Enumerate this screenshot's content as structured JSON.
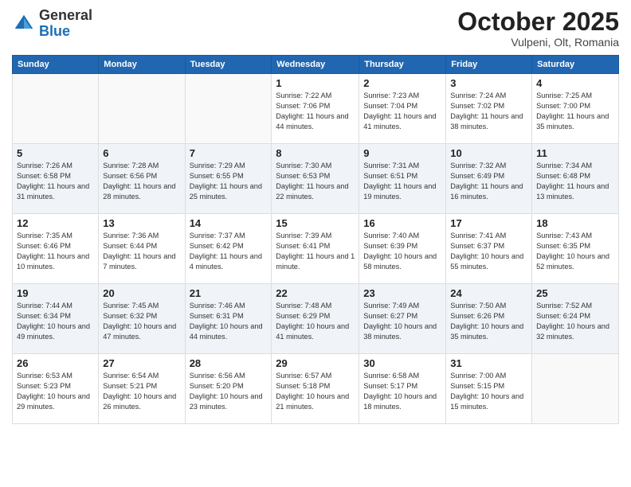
{
  "header": {
    "logo_general": "General",
    "logo_blue": "Blue",
    "month_title": "October 2025",
    "subtitle": "Vulpeni, Olt, Romania"
  },
  "days_of_week": [
    "Sunday",
    "Monday",
    "Tuesday",
    "Wednesday",
    "Thursday",
    "Friday",
    "Saturday"
  ],
  "weeks": [
    {
      "days": [
        {
          "number": "",
          "sunrise": "",
          "sunset": "",
          "daylight": ""
        },
        {
          "number": "",
          "sunrise": "",
          "sunset": "",
          "daylight": ""
        },
        {
          "number": "",
          "sunrise": "",
          "sunset": "",
          "daylight": ""
        },
        {
          "number": "1",
          "sunrise": "Sunrise: 7:22 AM",
          "sunset": "Sunset: 7:06 PM",
          "daylight": "Daylight: 11 hours and 44 minutes."
        },
        {
          "number": "2",
          "sunrise": "Sunrise: 7:23 AM",
          "sunset": "Sunset: 7:04 PM",
          "daylight": "Daylight: 11 hours and 41 minutes."
        },
        {
          "number": "3",
          "sunrise": "Sunrise: 7:24 AM",
          "sunset": "Sunset: 7:02 PM",
          "daylight": "Daylight: 11 hours and 38 minutes."
        },
        {
          "number": "4",
          "sunrise": "Sunrise: 7:25 AM",
          "sunset": "Sunset: 7:00 PM",
          "daylight": "Daylight: 11 hours and 35 minutes."
        }
      ]
    },
    {
      "days": [
        {
          "number": "5",
          "sunrise": "Sunrise: 7:26 AM",
          "sunset": "Sunset: 6:58 PM",
          "daylight": "Daylight: 11 hours and 31 minutes."
        },
        {
          "number": "6",
          "sunrise": "Sunrise: 7:28 AM",
          "sunset": "Sunset: 6:56 PM",
          "daylight": "Daylight: 11 hours and 28 minutes."
        },
        {
          "number": "7",
          "sunrise": "Sunrise: 7:29 AM",
          "sunset": "Sunset: 6:55 PM",
          "daylight": "Daylight: 11 hours and 25 minutes."
        },
        {
          "number": "8",
          "sunrise": "Sunrise: 7:30 AM",
          "sunset": "Sunset: 6:53 PM",
          "daylight": "Daylight: 11 hours and 22 minutes."
        },
        {
          "number": "9",
          "sunrise": "Sunrise: 7:31 AM",
          "sunset": "Sunset: 6:51 PM",
          "daylight": "Daylight: 11 hours and 19 minutes."
        },
        {
          "number": "10",
          "sunrise": "Sunrise: 7:32 AM",
          "sunset": "Sunset: 6:49 PM",
          "daylight": "Daylight: 11 hours and 16 minutes."
        },
        {
          "number": "11",
          "sunrise": "Sunrise: 7:34 AM",
          "sunset": "Sunset: 6:48 PM",
          "daylight": "Daylight: 11 hours and 13 minutes."
        }
      ]
    },
    {
      "days": [
        {
          "number": "12",
          "sunrise": "Sunrise: 7:35 AM",
          "sunset": "Sunset: 6:46 PM",
          "daylight": "Daylight: 11 hours and 10 minutes."
        },
        {
          "number": "13",
          "sunrise": "Sunrise: 7:36 AM",
          "sunset": "Sunset: 6:44 PM",
          "daylight": "Daylight: 11 hours and 7 minutes."
        },
        {
          "number": "14",
          "sunrise": "Sunrise: 7:37 AM",
          "sunset": "Sunset: 6:42 PM",
          "daylight": "Daylight: 11 hours and 4 minutes."
        },
        {
          "number": "15",
          "sunrise": "Sunrise: 7:39 AM",
          "sunset": "Sunset: 6:41 PM",
          "daylight": "Daylight: 11 hours and 1 minute."
        },
        {
          "number": "16",
          "sunrise": "Sunrise: 7:40 AM",
          "sunset": "Sunset: 6:39 PM",
          "daylight": "Daylight: 10 hours and 58 minutes."
        },
        {
          "number": "17",
          "sunrise": "Sunrise: 7:41 AM",
          "sunset": "Sunset: 6:37 PM",
          "daylight": "Daylight: 10 hours and 55 minutes."
        },
        {
          "number": "18",
          "sunrise": "Sunrise: 7:43 AM",
          "sunset": "Sunset: 6:35 PM",
          "daylight": "Daylight: 10 hours and 52 minutes."
        }
      ]
    },
    {
      "days": [
        {
          "number": "19",
          "sunrise": "Sunrise: 7:44 AM",
          "sunset": "Sunset: 6:34 PM",
          "daylight": "Daylight: 10 hours and 49 minutes."
        },
        {
          "number": "20",
          "sunrise": "Sunrise: 7:45 AM",
          "sunset": "Sunset: 6:32 PM",
          "daylight": "Daylight: 10 hours and 47 minutes."
        },
        {
          "number": "21",
          "sunrise": "Sunrise: 7:46 AM",
          "sunset": "Sunset: 6:31 PM",
          "daylight": "Daylight: 10 hours and 44 minutes."
        },
        {
          "number": "22",
          "sunrise": "Sunrise: 7:48 AM",
          "sunset": "Sunset: 6:29 PM",
          "daylight": "Daylight: 10 hours and 41 minutes."
        },
        {
          "number": "23",
          "sunrise": "Sunrise: 7:49 AM",
          "sunset": "Sunset: 6:27 PM",
          "daylight": "Daylight: 10 hours and 38 minutes."
        },
        {
          "number": "24",
          "sunrise": "Sunrise: 7:50 AM",
          "sunset": "Sunset: 6:26 PM",
          "daylight": "Daylight: 10 hours and 35 minutes."
        },
        {
          "number": "25",
          "sunrise": "Sunrise: 7:52 AM",
          "sunset": "Sunset: 6:24 PM",
          "daylight": "Daylight: 10 hours and 32 minutes."
        }
      ]
    },
    {
      "days": [
        {
          "number": "26",
          "sunrise": "Sunrise: 6:53 AM",
          "sunset": "Sunset: 5:23 PM",
          "daylight": "Daylight: 10 hours and 29 minutes."
        },
        {
          "number": "27",
          "sunrise": "Sunrise: 6:54 AM",
          "sunset": "Sunset: 5:21 PM",
          "daylight": "Daylight: 10 hours and 26 minutes."
        },
        {
          "number": "28",
          "sunrise": "Sunrise: 6:56 AM",
          "sunset": "Sunset: 5:20 PM",
          "daylight": "Daylight: 10 hours and 23 minutes."
        },
        {
          "number": "29",
          "sunrise": "Sunrise: 6:57 AM",
          "sunset": "Sunset: 5:18 PM",
          "daylight": "Daylight: 10 hours and 21 minutes."
        },
        {
          "number": "30",
          "sunrise": "Sunrise: 6:58 AM",
          "sunset": "Sunset: 5:17 PM",
          "daylight": "Daylight: 10 hours and 18 minutes."
        },
        {
          "number": "31",
          "sunrise": "Sunrise: 7:00 AM",
          "sunset": "Sunset: 5:15 PM",
          "daylight": "Daylight: 10 hours and 15 minutes."
        },
        {
          "number": "",
          "sunrise": "",
          "sunset": "",
          "daylight": ""
        }
      ]
    }
  ]
}
